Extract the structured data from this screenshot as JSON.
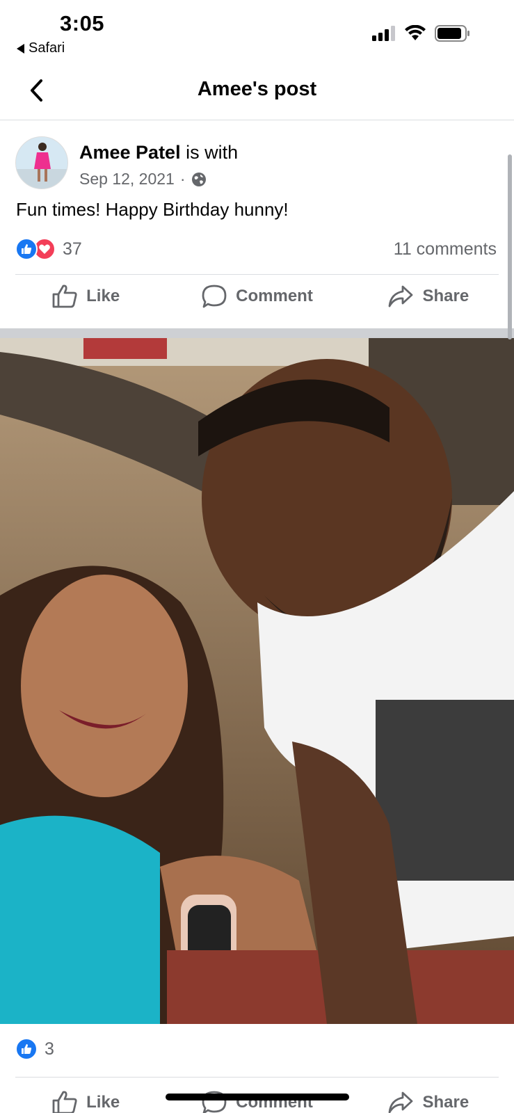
{
  "status_bar": {
    "time": "3:05",
    "back_app": "Safari",
    "icons": [
      "cellular-signal-icon",
      "wifi-icon",
      "battery-icon"
    ]
  },
  "nav": {
    "title": "Amee's post",
    "back_icon": "chevron-left-icon"
  },
  "post": {
    "author": "Amee Patel",
    "author_suffix": "is with",
    "date": "Sep 12, 2021",
    "separator": "·",
    "privacy_icon": "globe-icon",
    "text": "Fun times! Happy Birthday hunny!",
    "reaction_count": "37",
    "comment_count": "11 comments",
    "actions": {
      "like": "Like",
      "comment": "Comment",
      "share": "Share"
    }
  },
  "photo": {
    "reaction_count": "3",
    "actions": {
      "like": "Like",
      "comment": "Comment",
      "share": "Share"
    }
  },
  "colors": {
    "like_blue": "#1877f2",
    "love_red": "#f33e58",
    "secondary_text": "#65676b",
    "divider": "#dadde1"
  }
}
